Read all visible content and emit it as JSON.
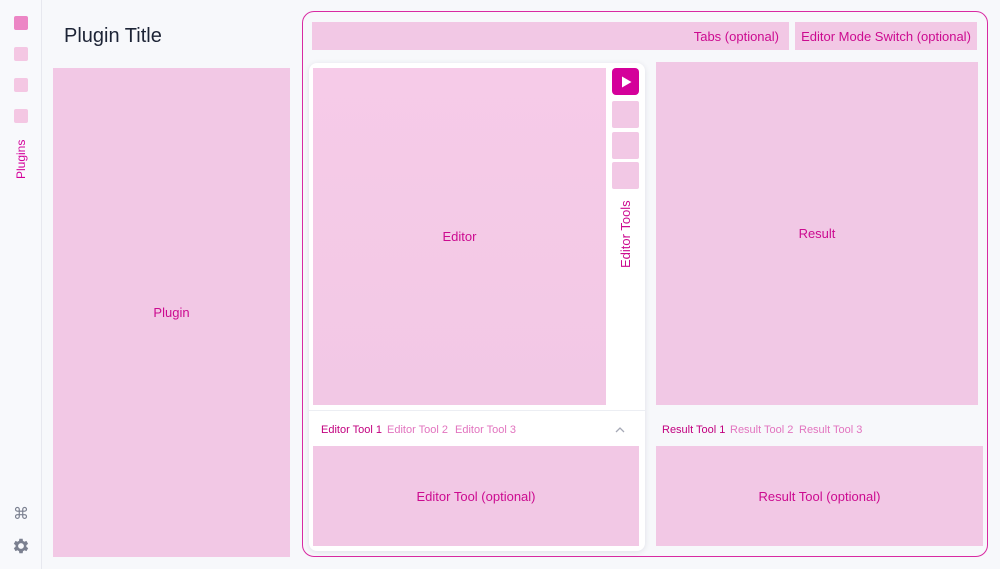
{
  "sidebar": {
    "plugins_label": "Plugins",
    "command_glyph": "⌘",
    "icons": [
      "plugin-slot-1",
      "plugin-slot-2",
      "plugin-slot-3",
      "plugin-slot-4",
      "command-icon",
      "gear-icon"
    ]
  },
  "plugin": {
    "title": "Plugin Title",
    "panel_label": "Plugin"
  },
  "header": {
    "tabs_label": "Tabs (optional)",
    "mode_switch_label": "Editor Mode Switch (optional)"
  },
  "editor": {
    "label": "Editor",
    "tools_label": "Editor Tools",
    "run_icon": "play-icon",
    "tool_tabs": [
      "Editor Tool 1",
      "Editor Tool 2",
      "Editor Tool 3"
    ],
    "tool_panel_label": "Editor Tool (optional)"
  },
  "result": {
    "label": "Result",
    "tool_tabs": [
      "Result Tool 1",
      "Result Tool 2",
      "Result Tool 3"
    ],
    "tool_panel_label": "Result Tool (optional)"
  },
  "colors": {
    "accent": "#d4009a",
    "placeholder_fill": "#f2c8e5",
    "active_sidebar_square": "#ec86c5",
    "frame_border": "#d82aa2"
  }
}
